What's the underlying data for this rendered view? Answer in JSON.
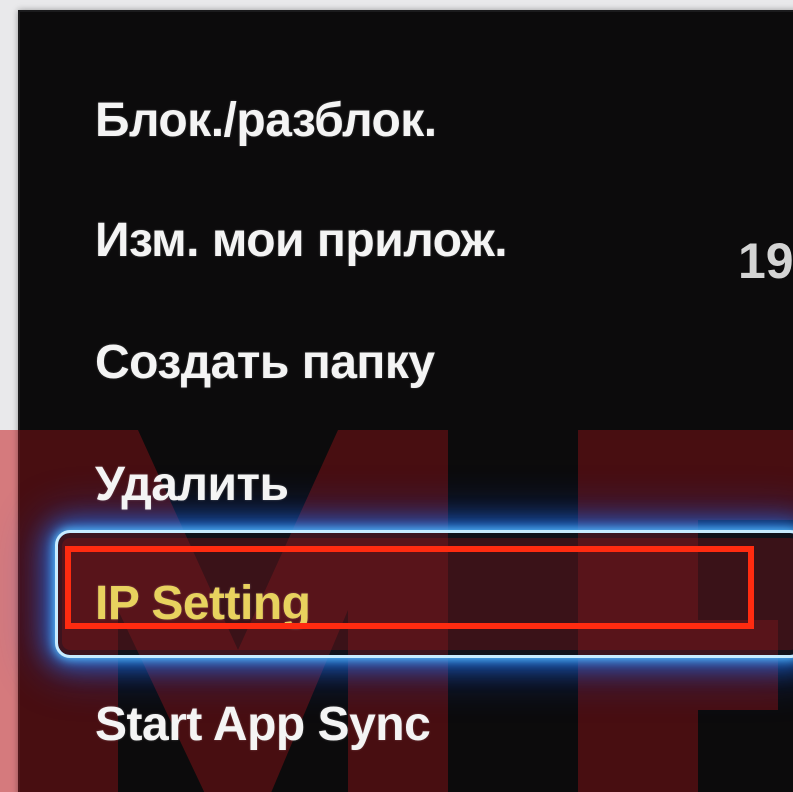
{
  "menu": {
    "items": [
      {
        "label": "Блок./разблок."
      },
      {
        "label": "Изм. мои прилож."
      },
      {
        "label": "Создать папку"
      },
      {
        "label": "Удалить"
      },
      {
        "label": "IP Setting"
      },
      {
        "label": "Start App Sync"
      }
    ],
    "selected_index": 4
  },
  "side_text": "19",
  "colors": {
    "panel_background": "#0c0b0c",
    "menu_text": "#f4f4f4",
    "selected_text": "#e8d25e",
    "focus_glow": "#2680ff",
    "annotation_box": "#ff2b10",
    "watermark": "#c51f23"
  }
}
